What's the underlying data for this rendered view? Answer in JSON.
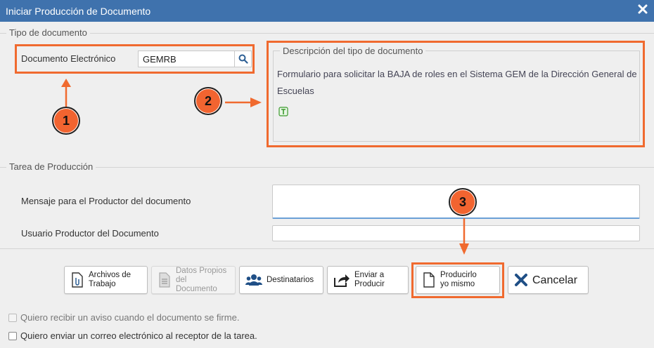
{
  "window": {
    "title": "Iniciar Producción de Documento"
  },
  "tipo_documento": {
    "legend": "Tipo de documento",
    "field_label": "Documento Electrónico",
    "field_value": "GEMRB"
  },
  "descripcion": {
    "legend": "Descripción del tipo de documento",
    "text": "Formulario para solicitar la BAJA de roles en el Sistema GEM de la Dirección General de Escuelas"
  },
  "tarea": {
    "legend": "Tarea de Producción",
    "mensaje_label": "Mensaje para el Productor del documento",
    "usuario_label": "Usuario Productor del Documento"
  },
  "buttons": {
    "archivos_line1": "Archivos de",
    "archivos_line2": "Trabajo",
    "datos_line1": "Datos Propios del",
    "datos_line2": "Documento",
    "destinatarios": "Destinatarios",
    "enviar_line1": "Enviar a",
    "enviar_line2": "Producir",
    "producir_line1": "Producirlo",
    "producir_line2": "yo mismo",
    "cancelar": "Cancelar"
  },
  "checks": {
    "aviso": "Quiero recibir un aviso cuando el documento se firme.",
    "correo": "Quiero enviar un correo electrónico al receptor de la tarea."
  },
  "callouts": {
    "one": "1",
    "two": "2",
    "three": "3"
  },
  "colors": {
    "titlebar": "#3f72ad",
    "highlight": "#f06a2f",
    "callout": "#f26430"
  }
}
